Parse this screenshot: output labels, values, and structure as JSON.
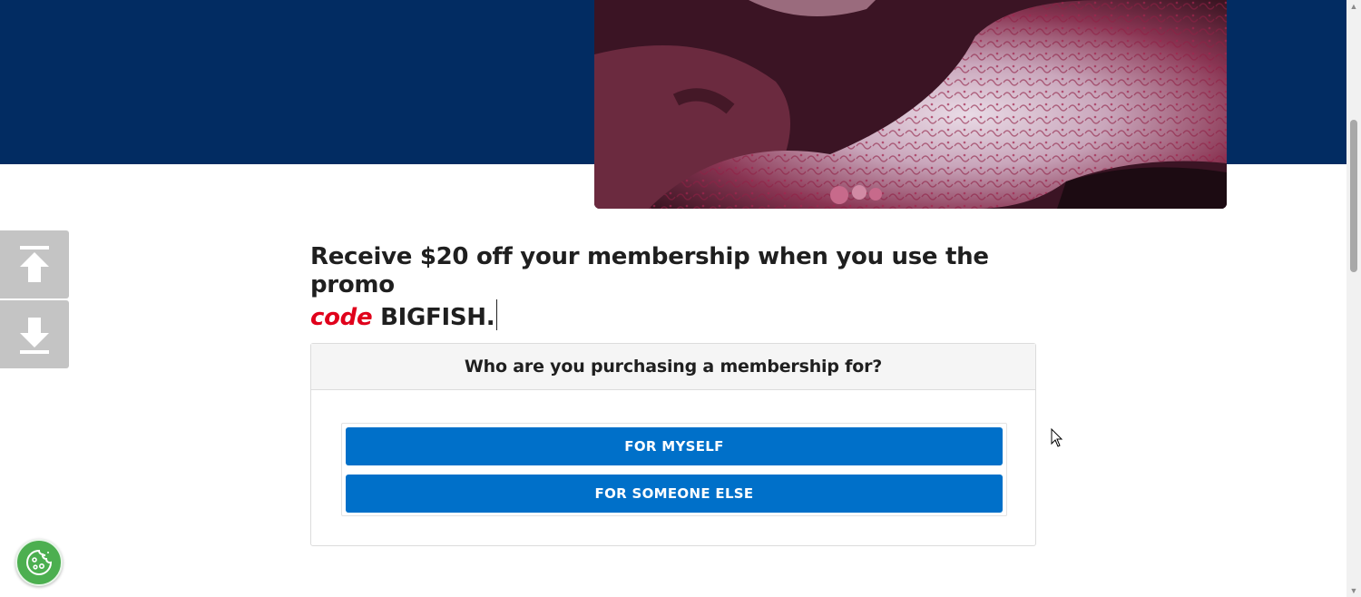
{
  "hero": {
    "image_icon": "octopus-photo"
  },
  "side_nav": {
    "up_icon": "arrow-up-bar-icon",
    "down_icon": "arrow-down-bar-icon"
  },
  "promo": {
    "text_before": "Receive $20 off your membership when you use the promo",
    "code_word": "code",
    "code_value": "BIGFISH."
  },
  "membership": {
    "question": "Who are you purchasing a membership for?",
    "options": [
      "FOR MYSELF",
      "FOR SOMEONE ELSE"
    ]
  },
  "colors": {
    "hero_navy": "#022c62",
    "button_blue": "#0070c9",
    "accent_red": "#e0001b",
    "cookie_green": "#4caf50"
  },
  "cookie": {
    "icon": "cookie-icon"
  }
}
